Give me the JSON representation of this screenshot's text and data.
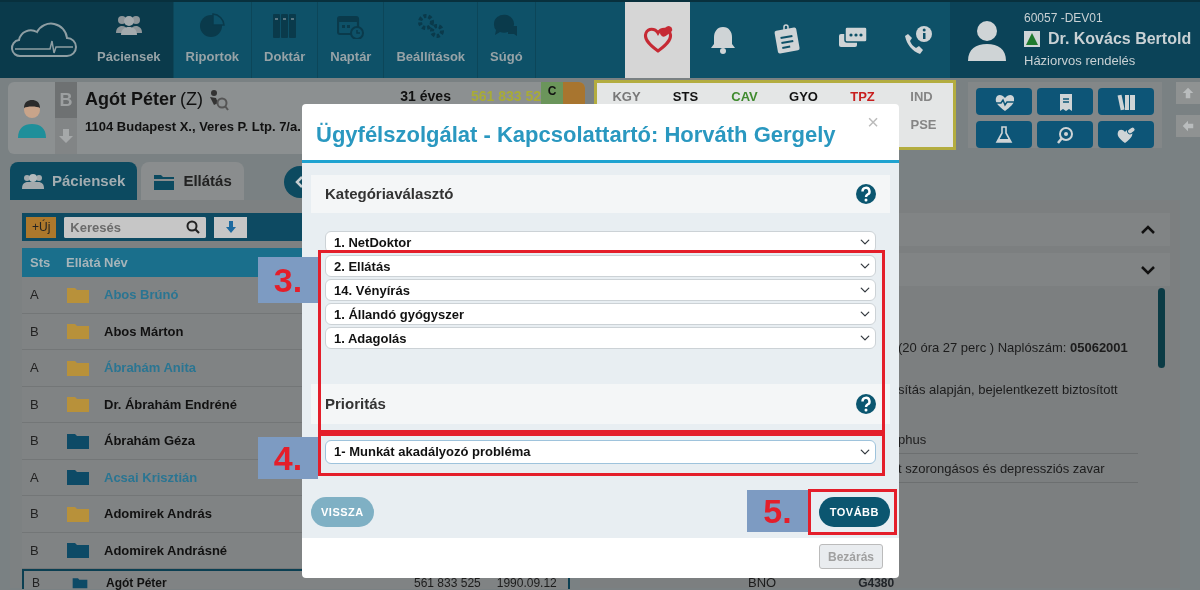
{
  "nav": [
    {
      "label": "Páciensek",
      "selected": true
    },
    {
      "label": "Riportok",
      "selected": false
    },
    {
      "label": "Doktár",
      "selected": false
    },
    {
      "label": "Naptár",
      "selected": false
    },
    {
      "label": "Beállítások",
      "selected": false
    },
    {
      "label": "Súgó",
      "selected": false
    }
  ],
  "tools": [
    {
      "selected": true
    },
    {
      "selected": false
    },
    {
      "selected": false
    },
    {
      "selected": false
    },
    {
      "selected": false
    }
  ],
  "user": {
    "code": "60057 -DEV01",
    "name": "Dr. Kovács Bertold",
    "role": "Háziorvos rendelés"
  },
  "patient": {
    "status": "B",
    "name": "Agót Péter",
    "suffix": "(Z)",
    "address": "1104 Budapest X., Veres P. Ltp. 7/a.",
    "age": "31 éves",
    "taj": "561 833 52",
    "flag": "C"
  },
  "indicators": [
    [
      {
        "label": "KGY",
        "color": "#777777"
      },
      {
        "label": "STS",
        "color": "#111111"
      },
      {
        "label": "CAV",
        "color": "#3f8a2e"
      },
      {
        "label": "GYO",
        "color": "#111111"
      },
      {
        "label": "TPZ",
        "color": "#c81e1e"
      },
      {
        "label": "IND",
        "color": "#858585"
      }
    ],
    [
      {
        "label": "PSE",
        "color": "#858585"
      }
    ]
  ],
  "tabs": [
    {
      "label": "Páciensek",
      "selected": true
    },
    {
      "label": "Ellátás",
      "selected": false
    }
  ],
  "patient_list": {
    "new_button": "+Új",
    "search": {
      "placeholder": "Keresés"
    },
    "columns": [
      "Sts",
      "Ellátá",
      "Név"
    ],
    "rows": [
      {
        "status": "A",
        "name": "Abos Brúnó",
        "highlighted": true,
        "color": "#b8913a",
        "selected": false
      },
      {
        "status": "B",
        "name": "Abos Márton",
        "highlighted": false,
        "color": "#b8913a",
        "selected": false
      },
      {
        "status": "A",
        "name": "Ábrahám Anita",
        "highlighted": true,
        "color": "#b8913a",
        "selected": false
      },
      {
        "status": "B",
        "name": "Dr. Ábrahám Endréné",
        "highlighted": false,
        "color": "#b8913a",
        "selected": false
      },
      {
        "status": "B",
        "name": "Ábrahám Géza",
        "highlighted": false,
        "color": "#0d4a66",
        "selected": false
      },
      {
        "status": "A",
        "name": "Acsai Krisztián",
        "highlighted": true,
        "color": "#0d4a66",
        "selected": false
      },
      {
        "status": "B",
        "name": "Adomirek András",
        "highlighted": false,
        "color": "#b8913a",
        "selected": false
      },
      {
        "status": "B",
        "name": "Adomirek Andrásné",
        "highlighted": false,
        "color": "#0d4a66",
        "selected": false
      },
      {
        "status": "B",
        "name": "Agót Péter",
        "highlighted": false,
        "color": "#0d4a66",
        "selected": true,
        "taj": "561 833 525",
        "born": "1990.09.12"
      }
    ]
  },
  "details": {
    "lines": [
      "(20 óra 27 perc ) Naplószám: **05062001**",
      "sítás alapján, bejelentkezett biztosított"
    ],
    "diagnoses": [
      "phus",
      "t szorongásos és depressziós zavar"
    ],
    "bno_label": "BNO",
    "bno_code": "G4380"
  },
  "dialog": {
    "title": "Ügyfélszolgálat - Kapcsolattartó: Horváth Gergely",
    "close": "×",
    "sections": [
      {
        "title": "Kategóriaválasztó",
        "selects": [
          "1. NetDoktor",
          "2. Ellátás",
          "14. Vényírás",
          "1. Állandó gyógyszer",
          "1. Adagolás"
        ]
      },
      {
        "title": "Prioritás",
        "selects": [
          "1- Munkát akadályozó probléma"
        ]
      }
    ],
    "back_button": {
      "label": "VISSZA",
      "disabled": true
    },
    "next_button": {
      "label": "TOVÁBB",
      "disabled": false
    },
    "close_button": {
      "label": "Bezárás",
      "disabled": true
    }
  },
  "annotations": [
    {
      "label": "3."
    },
    {
      "label": "4."
    },
    {
      "label": "5."
    }
  ]
}
